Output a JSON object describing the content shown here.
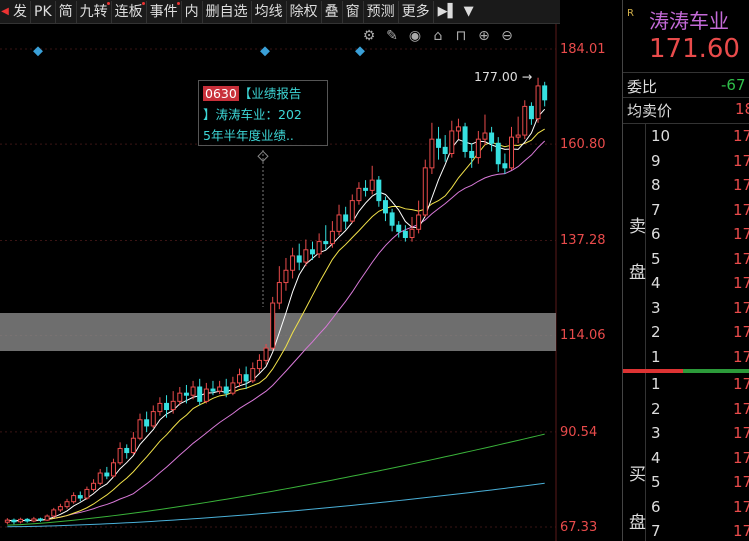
{
  "toolbar": {
    "items": [
      "发",
      "PK",
      "简",
      "九转",
      "连板",
      "事件",
      "内",
      "删自选",
      "均线",
      "除权",
      "叠",
      "窗",
      "预测",
      "更多"
    ]
  },
  "chart": {
    "price_axis": [
      "184.01",
      "160.80",
      "137.28",
      "114.06",
      "90.54",
      "67.33"
    ],
    "peak_label": "177.00",
    "tooltip": {
      "code": "0630",
      "line1": "【业绩报告",
      "line2": "】涛涛车业：202",
      "line3": "5年半年度业绩.."
    },
    "colors": {
      "up": "#e94b4b",
      "down": "#36e0e0",
      "ma5": "#ffffff",
      "ma10": "#f2e24a",
      "ma20": "#d879d8",
      "ma60": "#3ab33a",
      "ma120": "#4ab0d8"
    }
  },
  "chart_data": {
    "type": "candlestick",
    "ylim": [
      67.33,
      184.01
    ],
    "y_ticks": [
      184.01,
      160.8,
      137.28,
      114.06,
      90.54,
      67.33
    ],
    "candles": [
      [
        68.5,
        69.0,
        68.0,
        69.5
      ],
      [
        69.0,
        68.6,
        68.0,
        69.4
      ],
      [
        68.6,
        69.2,
        68.2,
        69.6
      ],
      [
        69.2,
        68.8,
        68.4,
        69.5
      ],
      [
        68.8,
        69.3,
        68.5,
        69.8
      ],
      [
        69.3,
        69.0,
        68.6,
        69.6
      ],
      [
        69.0,
        70.0,
        68.8,
        70.4
      ],
      [
        70.0,
        71.5,
        69.6,
        72.0
      ],
      [
        71.5,
        72.3,
        71.0,
        73.0
      ],
      [
        72.3,
        73.5,
        71.8,
        74.2
      ],
      [
        73.5,
        75.0,
        73.0,
        75.8
      ],
      [
        75.0,
        74.4,
        73.6,
        76.0
      ],
      [
        74.4,
        76.5,
        74.0,
        77.2
      ],
      [
        76.5,
        78.0,
        76.0,
        79.0
      ],
      [
        78.0,
        80.5,
        77.5,
        81.5
      ],
      [
        80.5,
        79.8,
        79.0,
        82.0
      ],
      [
        79.8,
        83.0,
        79.4,
        84.0
      ],
      [
        83.0,
        86.5,
        82.5,
        88.0
      ],
      [
        86.5,
        85.5,
        84.0,
        87.5
      ],
      [
        85.5,
        89.0,
        85.0,
        90.5
      ],
      [
        89.0,
        93.5,
        88.5,
        95.0
      ],
      [
        93.5,
        92.0,
        90.5,
        95.5
      ],
      [
        92.0,
        95.5,
        91.5,
        97.0
      ],
      [
        95.5,
        97.5,
        94.5,
        99.0
      ],
      [
        97.5,
        96.0,
        94.0,
        99.5
      ],
      [
        96.0,
        98.0,
        95.0,
        100.5
      ],
      [
        98.0,
        100.0,
        97.0,
        101.5
      ],
      [
        100.0,
        99.5,
        97.5,
        102.0
      ],
      [
        99.5,
        101.5,
        98.5,
        103.0
      ],
      [
        101.5,
        98.0,
        97.0,
        103.5
      ],
      [
        98.0,
        101.0,
        97.5,
        102.5
      ],
      [
        101.0,
        100.5,
        99.5,
        103.0
      ],
      [
        100.5,
        101.5,
        99.8,
        103.0
      ],
      [
        101.5,
        100.0,
        99.0,
        103.5
      ],
      [
        100.0,
        102.5,
        99.5,
        104.0
      ],
      [
        102.5,
        104.5,
        101.5,
        106.0
      ],
      [
        104.5,
        103.0,
        101.0,
        106.5
      ],
      [
        103.0,
        106.0,
        102.5,
        107.5
      ],
      [
        106.0,
        108.0,
        105.0,
        109.5
      ],
      [
        108.0,
        111.0,
        107.0,
        112.0
      ],
      [
        111.0,
        122.0,
        110.5,
        123.5
      ],
      [
        122.0,
        127.0,
        120.5,
        131.0
      ],
      [
        127.0,
        130.0,
        125.0,
        133.0
      ],
      [
        130.0,
        133.5,
        128.0,
        135.5
      ],
      [
        133.5,
        132.0,
        130.0,
        136.5
      ],
      [
        132.0,
        135.0,
        131.0,
        137.5
      ],
      [
        135.0,
        134.0,
        132.5,
        137.0
      ],
      [
        134.0,
        137.0,
        133.0,
        139.0
      ],
      [
        137.0,
        136.5,
        135.0,
        141.0
      ],
      [
        136.5,
        139.5,
        135.5,
        142.0
      ],
      [
        139.5,
        143.5,
        138.5,
        146.0
      ],
      [
        143.5,
        142.0,
        140.0,
        145.5
      ],
      [
        142.0,
        147.0,
        141.5,
        148.5
      ],
      [
        147.0,
        150.0,
        146.0,
        151.5
      ],
      [
        150.0,
        149.5,
        148.0,
        152.0
      ],
      [
        149.5,
        152.0,
        148.5,
        155.5
      ],
      [
        152.0,
        147.0,
        145.5,
        153.0
      ],
      [
        147.0,
        144.0,
        142.0,
        148.0
      ],
      [
        144.0,
        141.0,
        139.5,
        145.0
      ],
      [
        141.0,
        139.5,
        138.0,
        142.0
      ],
      [
        139.5,
        138.0,
        137.0,
        141.0
      ],
      [
        138.0,
        140.0,
        137.0,
        143.0
      ],
      [
        140.0,
        143.5,
        139.0,
        147.0
      ],
      [
        143.5,
        155.0,
        143.0,
        157.0
      ],
      [
        155.0,
        162.0,
        153.5,
        166.0
      ],
      [
        162.0,
        160.0,
        157.0,
        165.0
      ],
      [
        160.0,
        158.5,
        156.5,
        163.0
      ],
      [
        158.5,
        164.0,
        157.5,
        166.5
      ],
      [
        164.0,
        165.0,
        162.0,
        167.0
      ],
      [
        165.0,
        159.0,
        157.5,
        166.0
      ],
      [
        159.0,
        157.5,
        155.0,
        161.0
      ],
      [
        157.5,
        162.0,
        156.0,
        164.0
      ],
      [
        162.0,
        163.5,
        160.5,
        168.0
      ],
      [
        163.5,
        161.0,
        159.0,
        165.0
      ],
      [
        161.0,
        156.0,
        154.0,
        162.5
      ],
      [
        156.0,
        155.0,
        153.5,
        158.5
      ],
      [
        155.0,
        162.5,
        154.5,
        165.0
      ],
      [
        162.5,
        163.0,
        161.0,
        167.5
      ],
      [
        163.0,
        170.0,
        162.0,
        171.5
      ],
      [
        170.0,
        167.0,
        165.5,
        171.0
      ],
      [
        167.0,
        175.0,
        166.0,
        177.0
      ],
      [
        175.0,
        171.6,
        170.0,
        176.0
      ]
    ],
    "ma5_end": 162.0,
    "ma20_end": 155.0,
    "ma60_end": 90.0,
    "ma120_end": 78.0
  },
  "panel": {
    "badge": "R",
    "name": "涛涛车业",
    "last_price": "171.60",
    "weibi_label": "委比",
    "weibi_value": "-67",
    "avg_sell_label": "均卖价",
    "avg_sell_value": "18",
    "sell_label_1": "卖",
    "sell_label_2": "盘",
    "buy_label_1": "买",
    "buy_label_2": "盘",
    "sell_levels": [
      "10",
      "9",
      "8",
      "7",
      "6",
      "5",
      "4",
      "3",
      "2",
      "1"
    ],
    "buy_levels": [
      "1",
      "2",
      "3",
      "4",
      "5",
      "6",
      "7"
    ],
    "level_price_prefix": "17",
    "colors": {
      "name": "#c46ad8",
      "price": "#e94b4b",
      "negative": "#2fbf4a"
    }
  }
}
